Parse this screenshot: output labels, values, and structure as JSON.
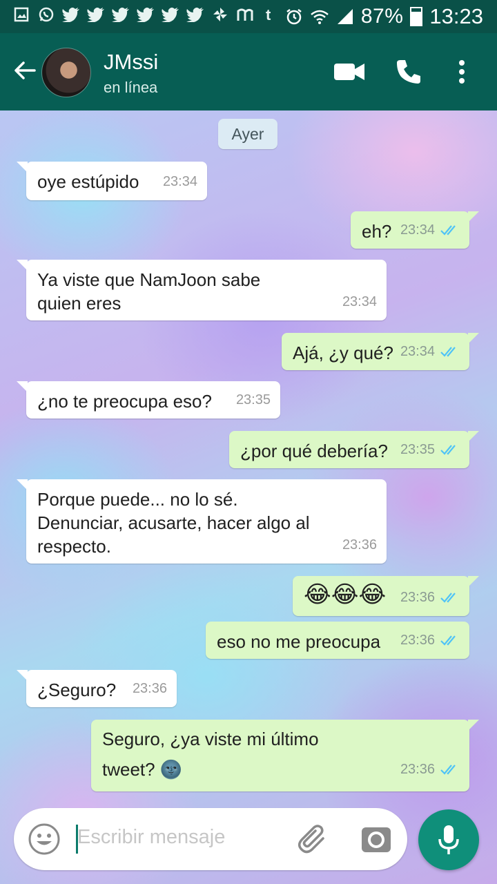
{
  "status_bar": {
    "battery": "87%",
    "time": "13:23",
    "left_icons": [
      "gallery-icon",
      "whatsapp-icon",
      "twitter-icon",
      "twitter-icon",
      "twitter-icon",
      "twitter-icon",
      "twitter-icon",
      "twitter-icon",
      "pinwheel-icon",
      "m-app-icon",
      "tumblr-icon"
    ],
    "right_icons": [
      "alarm-icon",
      "wifi-icon",
      "signal-icon",
      "battery-icon"
    ]
  },
  "header": {
    "contact_name": "JMssi",
    "status": "en línea",
    "icons": [
      "back-arrow-icon",
      "video-call-icon",
      "phone-icon",
      "more-vert-icon"
    ]
  },
  "chat": {
    "date_chip": "Ayer",
    "messages": [
      {
        "dir": "in",
        "text": "oye estúpido",
        "time": "23:34"
      },
      {
        "dir": "out",
        "text": "eh?",
        "time": "23:34",
        "read": true
      },
      {
        "dir": "in",
        "text": "Ya viste que NamJoon sabe\nquien eres",
        "time": "23:34"
      },
      {
        "dir": "out",
        "text": "Ajá, ¿y qué?",
        "time": "23:34",
        "read": true
      },
      {
        "dir": "in",
        "text": "¿no te preocupa eso?",
        "time": "23:35"
      },
      {
        "dir": "out",
        "text": "¿por qué debería?",
        "time": "23:35",
        "read": true
      },
      {
        "dir": "in",
        "text": "Porque puede... no lo sé.\nDenunciar, acusarte, hacer algo al\nrespecto.",
        "time": "23:36"
      },
      {
        "dir": "out",
        "text": "😂😂😂",
        "time": "23:36",
        "read": true
      },
      {
        "dir": "out",
        "text": "eso no me preocupa",
        "time": "23:36",
        "read": true
      },
      {
        "dir": "in",
        "text": "¿Seguro?",
        "time": "23:36"
      },
      {
        "dir": "out",
        "text": "Seguro, ¿ya viste mi último\ntweet? 🌚",
        "time": "23:36",
        "read": true
      }
    ]
  },
  "composer": {
    "placeholder": "Escribir mensaje",
    "icons": [
      "emoji-icon",
      "attach-icon",
      "camera-icon",
      "mic-icon"
    ]
  },
  "colors": {
    "app_bar": "#075e54",
    "status_bar": "#0a5148",
    "outgoing_bubble": "#dcf8c6",
    "incoming_bubble": "#ffffff",
    "read_ticks": "#4fc3f7",
    "mic_button": "#0f8f7a"
  }
}
